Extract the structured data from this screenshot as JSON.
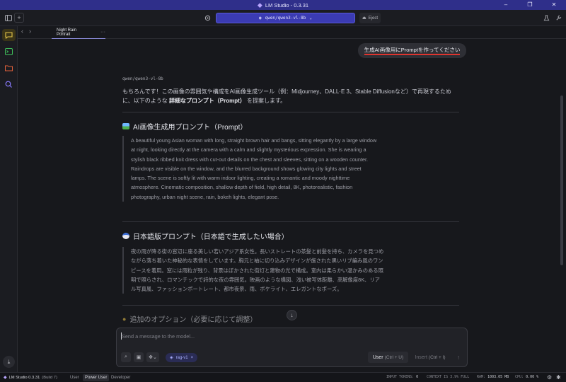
{
  "window": {
    "app_title": "LM Studio - 0.3.31",
    "controls": [
      "–",
      "❐",
      "✕"
    ]
  },
  "header": {
    "model_name": "qwen/qwen3-vl-8b",
    "eject_label": "Eject"
  },
  "tab": {
    "label": "Night Rain Portrait",
    "more": "···"
  },
  "chat": {
    "user_message": "生成AI画像用にPromptを作ってください",
    "assistant_model": "qwen/qwen3-vl-8b",
    "intro_part1": "もちろんです！この画像の雰囲気や構成をAI画像生成ツール（例：Midjourney、DALL·E 3、Stable Diffusionなど）で再現するために、以下のような ",
    "intro_bold": "詳細なプロンプト（Prompt）",
    "intro_part2": " を提案します。",
    "section1_title": "AI画像生成用プロンプト（Prompt）",
    "section1_body": "A beautiful young Asian woman with long, straight brown hair and bangs, sitting elegantly by a large window at night, looking directly at the camera with a calm and slightly mysterious expression. She is wearing a stylish black ribbed knit dress with cut-out details on the chest and sleeves, sitting on a wooden counter. Raindrops are visible on the window, and the blurred background shows glowing city lights and street lamps. The scene is softly lit with warm indoor lighting, creating a romantic and moody nighttime atmosphere. Cinematic composition, shallow depth of field, high detail, 8K, photorealistic, fashion photography, urban night scene, rain, bokeh lights, elegant pose.",
    "section2_title": "日本語版プロンプト（日本語で生成したい場合）",
    "section2_body": "夜の雨が降る街の窓辺に座る美しい若いアジア系女性。長いストレートの茶髪と前髪を持ち、カメラを見つめながら落ち着いた神秘的な表情をしています。胸元と袖に切り込みデザインが施された黒いリブ編み風のワンピースを着用。窓には雨粒が残り、背景はぼかされた街灯と建物の光で構成。室内は柔らかい温かみのある照明で照らされ、ロマンチックで詩的な夜の雰囲気。映画のような構図、浅い被写体距離、高解像度8K、リアル写真風、ファッションポートレート、都市夜景、雨、ボケライト、エレガントなポーズ。",
    "section3_title": "追加のオプション（必要に応じて調整）"
  },
  "composer": {
    "placeholder": "Send a message to the model...",
    "rag_label": "rag-v1",
    "rag_close": "×",
    "send_user_label": "User",
    "send_user_shortcut": "(Ctrl + U)",
    "insert_label": "Insert",
    "insert_shortcut": "(Ctrl + I)"
  },
  "status": {
    "brand": "LM Studio 0.3.31",
    "build": "(Build 7)",
    "modes": [
      "User",
      "Power User",
      "Developer"
    ],
    "selected_mode": "Power User",
    "input_tokens_label": "INPUT TOKENS:",
    "input_tokens_value": "0",
    "context_label": "CONTEXT IS 3.9% FULL",
    "ram_label": "RAM:",
    "ram_value": "1003.05 MB",
    "cpu_label": "CPU:",
    "cpu_value": "0.00 %"
  },
  "colors": {
    "accent": "#3b3bb3",
    "titlebar": "#2f2f8a",
    "highlight_underline": "#e0352f"
  }
}
